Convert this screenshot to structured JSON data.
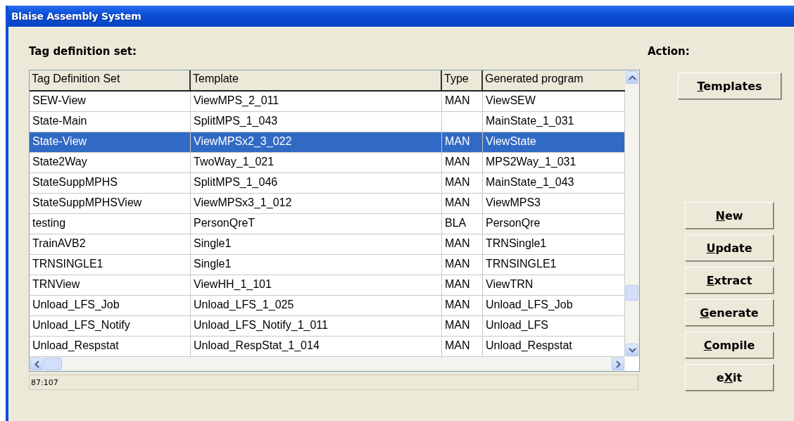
{
  "window": {
    "title": "Blaise Assembly System"
  },
  "list_label": "Tag definition set:",
  "action_label": "Action:",
  "table": {
    "columns": [
      "Tag Definition Set",
      "Template",
      "Type",
      "Generated program"
    ],
    "rows": [
      {
        "cells": [
          "SEW-View",
          "ViewMPS_2_011",
          "MAN",
          "ViewSEW"
        ],
        "selected": false
      },
      {
        "cells": [
          "State-Main",
          "SplitMPS_1_043",
          null,
          "MainState_1_031"
        ],
        "selected": false
      },
      {
        "cells": [
          "State-View",
          "ViewMPSx2_3_022",
          "MAN",
          "ViewState"
        ],
        "selected": true
      },
      {
        "cells": [
          "State2Way",
          "TwoWay_1_021",
          "MAN",
          "MPS2Way_1_031"
        ],
        "selected": false
      },
      {
        "cells": [
          "StateSuppMPHS",
          "SplitMPS_1_046",
          "MAN",
          "MainState_1_043"
        ],
        "selected": false
      },
      {
        "cells": [
          "StateSuppMPHSView",
          "ViewMPSx3_1_012",
          "MAN",
          "ViewMPS3"
        ],
        "selected": false
      },
      {
        "cells": [
          "testing",
          "PersonQreT",
          "BLA",
          "PersonQre"
        ],
        "selected": false
      },
      {
        "cells": [
          "TrainAVB2",
          "Single1",
          "MAN",
          "TRNSingle1"
        ],
        "selected": false
      },
      {
        "cells": [
          "TRNSINGLE1",
          "Single1",
          "MAN",
          "TRNSINGLE1"
        ],
        "selected": false
      },
      {
        "cells": [
          "TRNView",
          "ViewHH_1_101",
          "MAN",
          "ViewTRN"
        ],
        "selected": false
      },
      {
        "cells": [
          "Unload_LFS_Job",
          "Unload_LFS_1_025",
          "MAN",
          "Unload_LFS_Job"
        ],
        "selected": false
      },
      {
        "cells": [
          "Unload_LFS_Notify",
          "Unload_LFS_Notify_1_011",
          "MAN",
          "Unload_LFS"
        ],
        "selected": false
      },
      {
        "cells": [
          "Unload_Respstat",
          "Unload_RespStat_1_014",
          "MAN",
          "Unload_Respstat"
        ],
        "selected": false
      }
    ]
  },
  "status_bar": "87:107",
  "templates_button": {
    "key": "T",
    "rest": "emplates"
  },
  "buttons": [
    {
      "key": "N",
      "rest": "ew"
    },
    {
      "key": "U",
      "rest": "pdate"
    },
    {
      "key": "E",
      "rest": "xtract"
    },
    {
      "key": "G",
      "rest": "enerate"
    },
    {
      "key": "C",
      "rest": "ompile"
    },
    {
      "lead": "e",
      "key": "X",
      "rest": "it"
    }
  ]
}
